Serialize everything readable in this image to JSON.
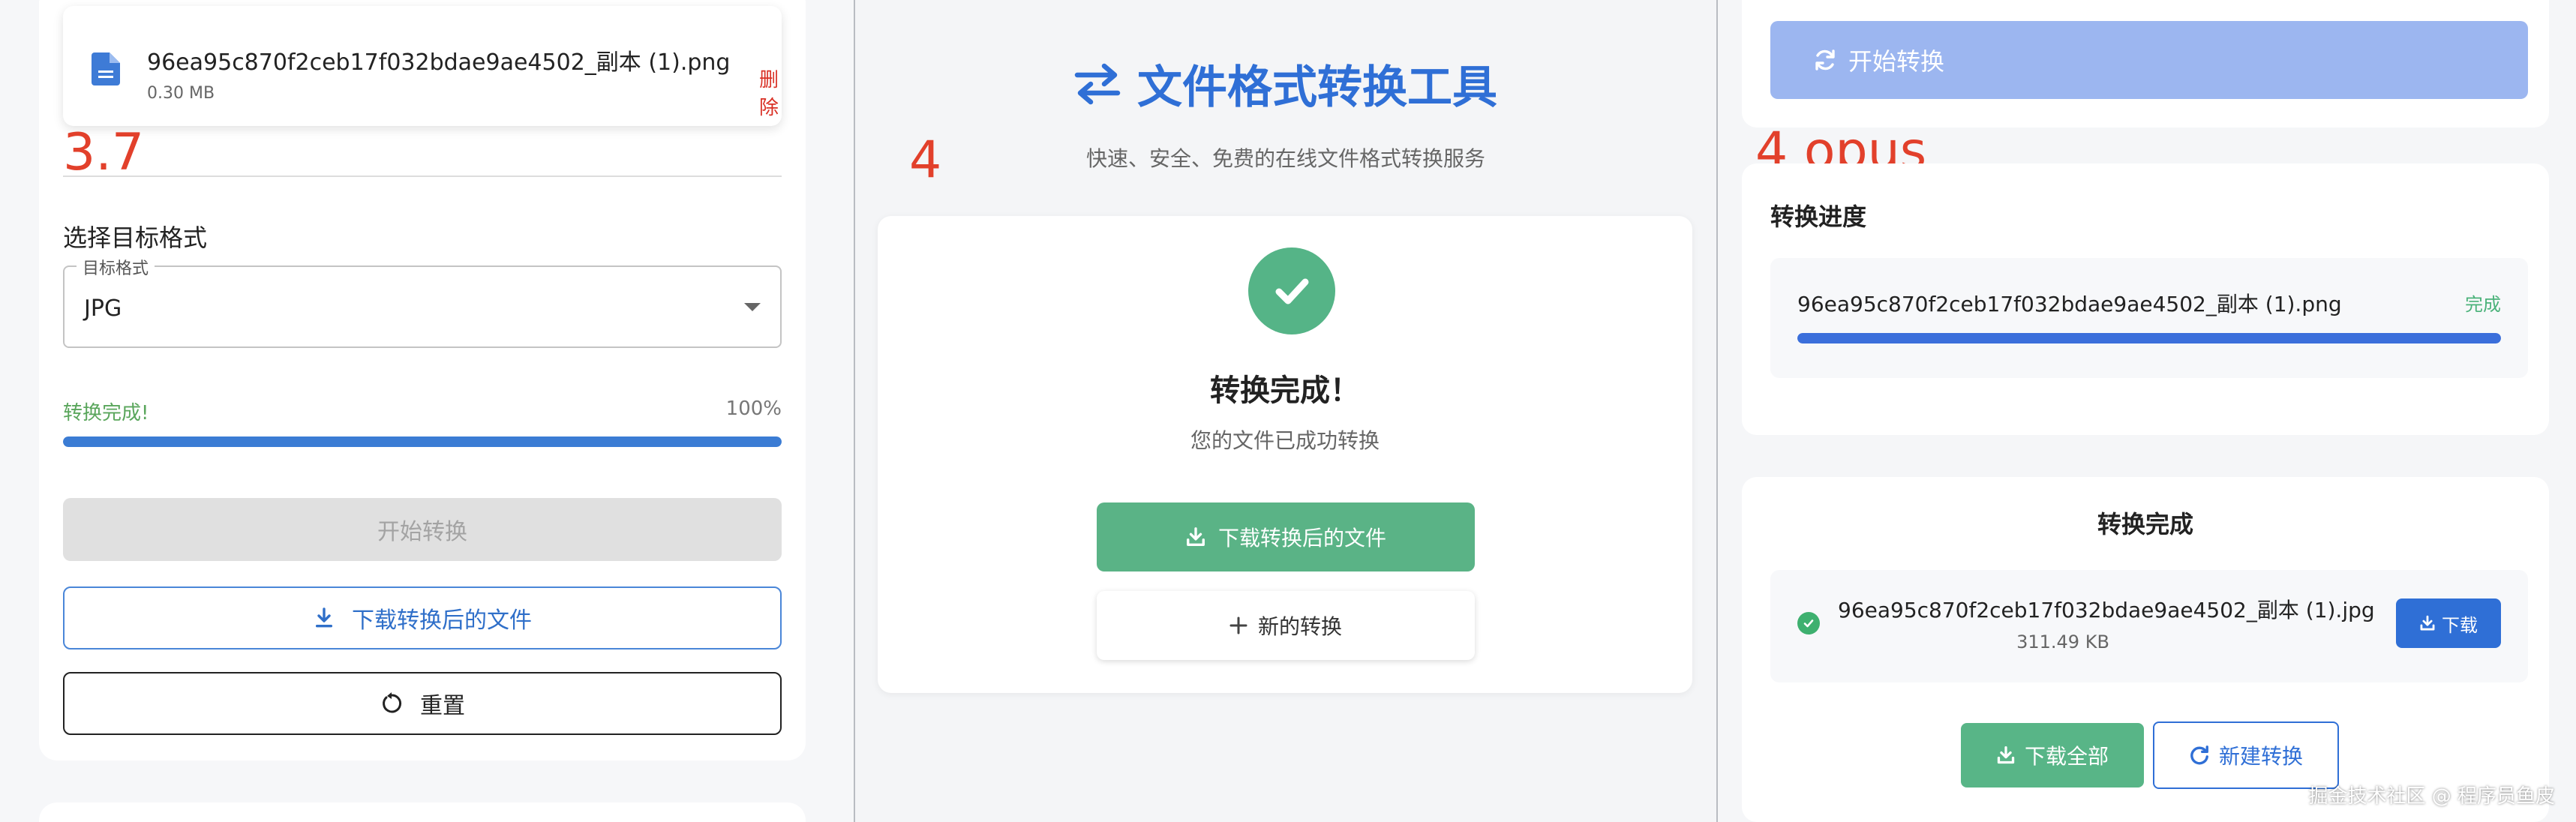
{
  "panel1": {
    "version_label": "3.7",
    "file": {
      "name": "96ea95c870f2ceb17f032bdae9ae4502_副本 (1).png",
      "size": "0.30 MB",
      "delete_label": "删除"
    },
    "section_title": "选择目标格式",
    "select": {
      "legend": "目标格式",
      "value": "JPG"
    },
    "status_text": "转换完成!",
    "percent_text": "100%",
    "progress": 1.0,
    "start_button": "开始转换",
    "download_button": "下载转换后的文件",
    "reset_button": "重置"
  },
  "panel2": {
    "version_label": "4",
    "title": "文件格式转换工具",
    "subtitle": "快速、安全、免费的在线文件格式转换服务",
    "done_title": "转换完成！",
    "done_subtitle": "您的文件已成功转换",
    "download_button": "下载转换后的文件",
    "new_button": "新的转换"
  },
  "panel3": {
    "version_label": "4 opus",
    "start_button": "开始转换",
    "progress_title": "转换进度",
    "progress_item": {
      "name": "96ea95c870f2ceb17f032bdae9ae4502_副本 (1).png",
      "status": "完成",
      "progress": 1.0
    },
    "done_title": "转换完成",
    "done_item": {
      "name": "96ea95c870f2ceb17f032bdae9ae4502_副本 (1).jpg",
      "size": "311.49 KB",
      "download_label": "下载"
    },
    "download_all_button": "下载全部",
    "new_button": "新建转换",
    "watermark": "掘金技术社区 @ 程序员鱼皮"
  },
  "colors": {
    "label_red": "#e2402b",
    "primary_blue": "#2f6fd6",
    "success_green": "#5ab386",
    "progress_blue": "#3b7cd4",
    "disabled_blue": "#9cb6f0"
  }
}
